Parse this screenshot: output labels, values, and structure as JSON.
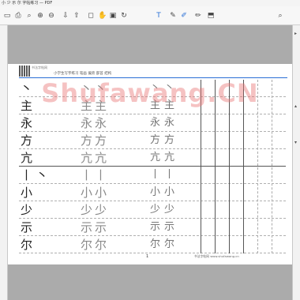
{
  "window": {
    "title": "小 少 示 尔 字帖练习 — PDF"
  },
  "toolbar": {
    "icons": [
      "save-icon",
      "print-icon",
      "find-icon",
      "zoom-in-icon",
      "zoom-out-icon",
      "page-down-icon",
      "page-up-icon",
      "fit-page-icon",
      "hand-icon",
      "select-icon",
      "rotate-icon",
      "text-icon",
      "comment-icon",
      "highlight-icon",
      "draw-icon",
      "stamp-icon",
      "search-icon"
    ]
  },
  "header": {
    "brand": "书法字帖网",
    "subtitle": "小学生写字练习 笔画 偏旁 部首 结构"
  },
  "rows": [
    {
      "model": "丶",
      "traces": [
        "丶",
        "丶"
      ],
      "guides": [
        "丶",
        "丶"
      ]
    },
    {
      "model": "主",
      "traces": [
        "主",
        "主"
      ],
      "guides": [
        "主",
        "主"
      ]
    },
    {
      "model": "永",
      "traces": [
        "永",
        "永"
      ],
      "guides": [
        "永",
        "永"
      ]
    },
    {
      "model": "方",
      "traces": [
        "方",
        "方"
      ],
      "guides": [
        "方",
        "方"
      ]
    },
    {
      "model": "亢",
      "traces": [
        "亢",
        "亢"
      ],
      "guides": [
        "亢",
        "亢"
      ]
    },
    {
      "model": "丨 丶",
      "traces": [
        "丨",
        "丨"
      ],
      "guides": [
        "丨",
        "丨"
      ]
    },
    {
      "model": "小",
      "traces": [
        "小",
        "小"
      ],
      "guides": [
        "小",
        "小"
      ]
    },
    {
      "model": "少",
      "traces": [
        "少",
        "少"
      ],
      "guides": [
        "少",
        "少"
      ]
    },
    {
      "model": "示",
      "traces": [
        "示",
        "示"
      ],
      "guides": [
        "示",
        "示"
      ]
    },
    {
      "model": "尔",
      "traces": [
        "尔",
        "尔"
      ],
      "guides": [
        "尔",
        "尔"
      ]
    }
  ],
  "page_number": "1",
  "footer": "书法字帖网 www.shufawang.cn",
  "watermark": "Shufawang.CN"
}
